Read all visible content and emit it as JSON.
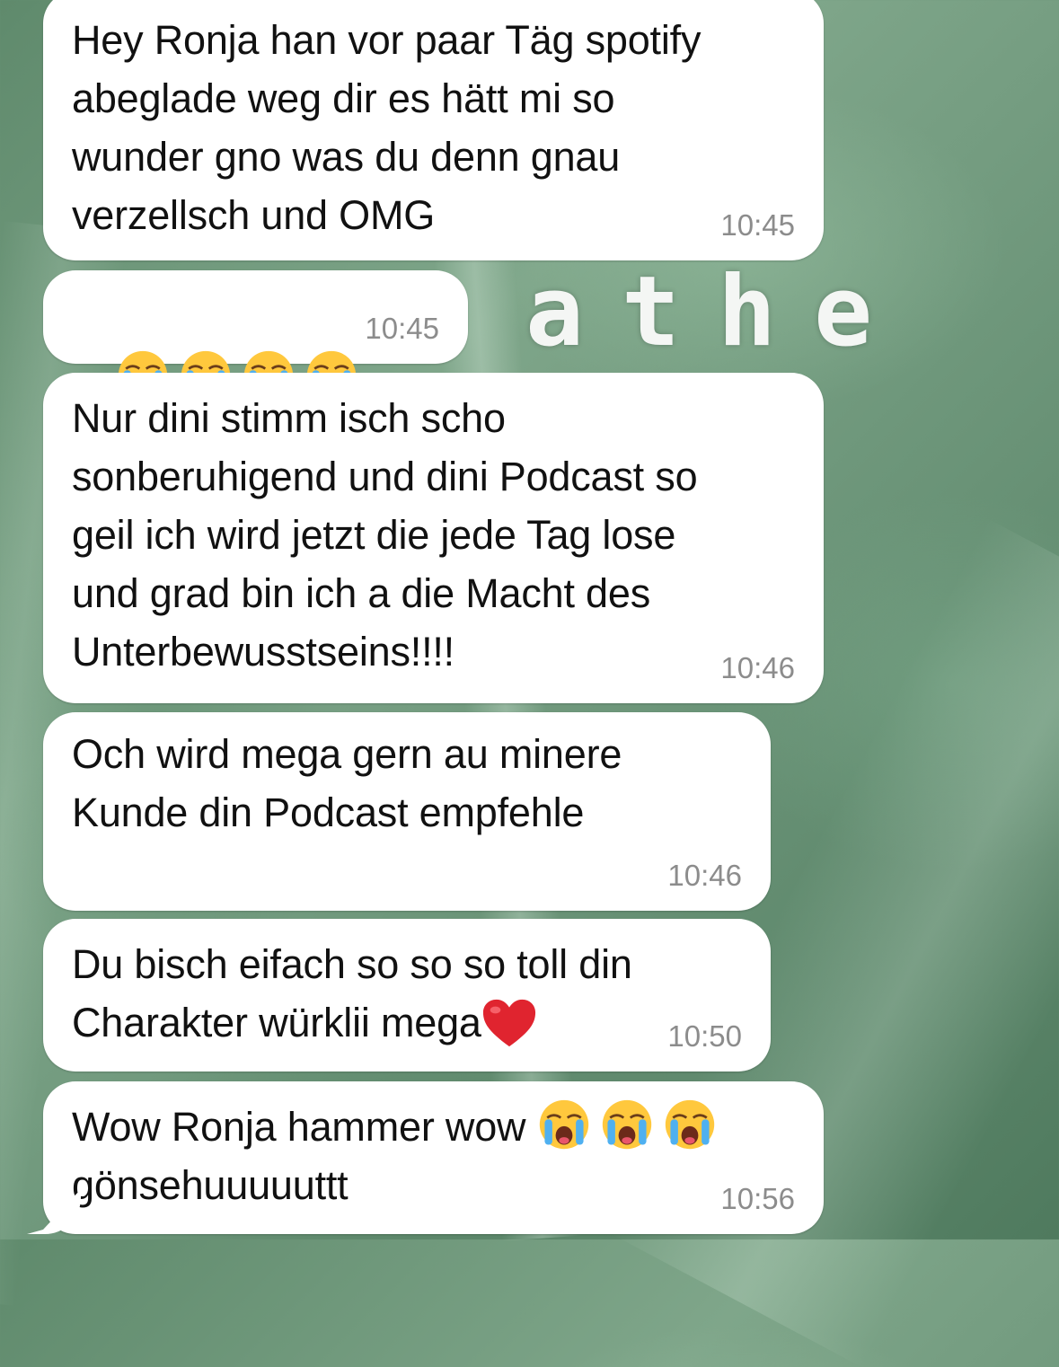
{
  "wallpaper": {
    "letters": "athe"
  },
  "messages": [
    {
      "text": "Hey Ronja han vor paar Täg spotify\nabeglade weg dir es hätt mi so\nwunder gno was du denn gnau\nverzellsch und OMG",
      "time": "10:45"
    },
    {
      "emojis": [
        "loudly-crying-face",
        "loudly-crying-face",
        "loudly-crying-face",
        "loudly-crying-face"
      ],
      "time": "10:45"
    },
    {
      "text": "Nur dini stimm isch scho\nsonberuhigend und dini Podcast so\ngeil ich wird jetzt die jede Tag lose\nund grad bin ich a die Macht des\nUnterbewusstseins!!!!",
      "time": "10:46"
    },
    {
      "text": "Och wird mega gern au minere\nKunde din Podcast empfehle",
      "time": "10:46"
    },
    {
      "line1": "Du bisch eifach so so so toll din",
      "line2": "Charakter würklii mega",
      "trailing_emoji": "red-heart",
      "time": "10:50"
    },
    {
      "line1": "Wow Ronja hammer wow ",
      "line1_emojis": [
        "loudly-crying-face",
        "loudly-crying-face",
        "loudly-crying-face"
      ],
      "line2": "gönsehuuuuuttt",
      "time": "10:56"
    }
  ],
  "colors": {
    "bubble": "#ffffff",
    "time": "#8c8c8c",
    "text": "#111111"
  }
}
